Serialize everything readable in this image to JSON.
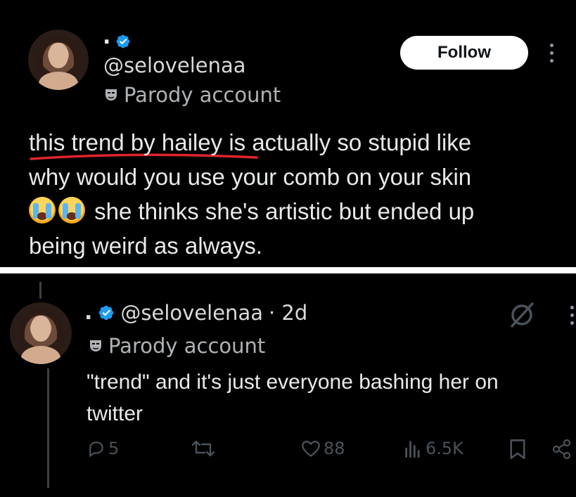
{
  "original_post": {
    "display_name": ".",
    "handle": "@selovelenaa",
    "parody_label": "Parody account",
    "follow_label": "Follow",
    "text_line1": "this trend by hailey is actually so stupid like",
    "text_line2": "why would you use your comb on your skin",
    "text_line3": "she thinks she's artistic but ended up",
    "text_line4": "being weird as always.",
    "emojis": [
      "loudly-crying-face",
      "loudly-crying-face"
    ]
  },
  "reply": {
    "display_name": ".",
    "handle": "@selovelenaa",
    "time": "· 2d",
    "parody_label": "Parody account",
    "text_line1": "\"trend\" and it's just everyone bashing her on",
    "text_line2": "twitter",
    "actions": {
      "replies": "5",
      "likes": "88",
      "views": "6.5K"
    }
  },
  "colors": {
    "background": "#000000",
    "text": "#e7e9ea",
    "verified": "#1d9bf0",
    "underline": "#e0242b",
    "divider": "#ffffff",
    "muted_icon": "#4b5259"
  }
}
